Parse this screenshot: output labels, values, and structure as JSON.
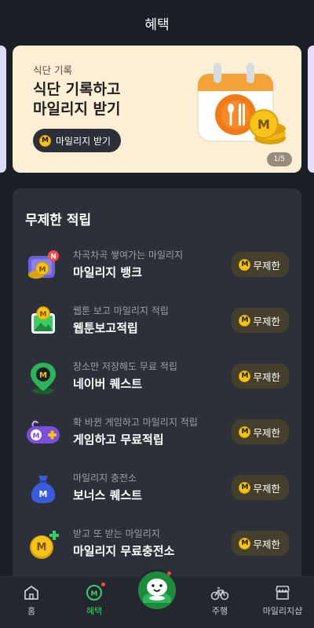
{
  "header": {
    "title": "혜택"
  },
  "banner": {
    "eyebrow": "식단 기록",
    "headline_line1": "식단 기록하고",
    "headline_line2": "마일리지 받기",
    "cta_label": "마일리지 받기",
    "coin_letter": "M",
    "pager": "1/5",
    "bg_color": "#fcefd6"
  },
  "section": {
    "title": "무제한 적립",
    "items": [
      {
        "subtitle": "차곡차곡 쌓여가는 마일리지",
        "title": "마일리지 뱅크",
        "badge": "무제한",
        "icon": "mileage-bank-icon",
        "new_mark": "N"
      },
      {
        "subtitle": "웹툰 보고 마일리지 적립",
        "title": "웹툰보고적립",
        "badge": "무제한",
        "icon": "webtoon-icon"
      },
      {
        "subtitle": "장소만 저장해도 무료 적립",
        "title": "네이버 퀘스트",
        "badge": "무제한",
        "icon": "map-pin-icon"
      },
      {
        "subtitle": "확 바뀐 게임하고 마일리지 적립",
        "title": "게임하고 무료적립",
        "badge": "무제한",
        "icon": "gamepad-icon"
      },
      {
        "subtitle": "마일리지 충전소",
        "title": "보너스 퀘스트",
        "badge": "무제한",
        "icon": "money-bag-icon"
      },
      {
        "subtitle": "받고 또 받는 마일리지",
        "title": "마일리지 무료충전소",
        "badge": "무제한",
        "icon": "coin-plus-icon"
      }
    ]
  },
  "tabbar": {
    "tabs": [
      {
        "label": "홈",
        "icon": "home-icon"
      },
      {
        "label": "혜택",
        "icon": "benefit-icon",
        "active": true
      },
      {
        "label": "",
        "icon": "character-icon"
      },
      {
        "label": "주행",
        "icon": "bicycle-icon"
      },
      {
        "label": "마일리지샵",
        "icon": "shop-icon"
      }
    ]
  },
  "colors": {
    "background": "#1b1f26",
    "card": "#2c3039",
    "accent_green": "#3ccd6a",
    "coin_yellow": "#f5c31b",
    "badge_bg": "#45402d"
  }
}
